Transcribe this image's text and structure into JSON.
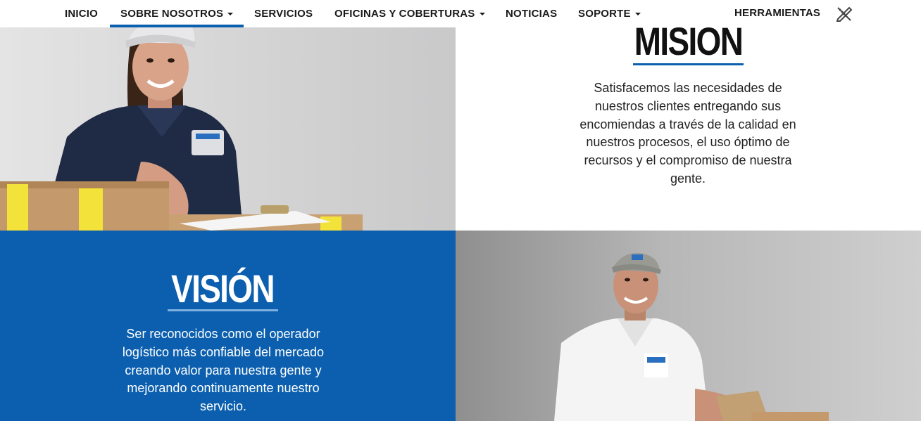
{
  "nav": {
    "items": [
      {
        "label": "INICIO",
        "dropdown": false
      },
      {
        "label": "SOBRE NOSOTROS",
        "dropdown": true
      },
      {
        "label": "SERVICIOS",
        "dropdown": false
      },
      {
        "label": "OFICINAS Y COBERTURAS",
        "dropdown": true
      },
      {
        "label": "NOTICIAS",
        "dropdown": false
      },
      {
        "label": "SOPORTE",
        "dropdown": true
      },
      {
        "label": "HERRAMIENTAS",
        "dropdown": false
      }
    ],
    "active_index": 1,
    "tools_icon": "pencil-ruler-icon"
  },
  "mission": {
    "title": "MISIÓN",
    "text": "Satisfacemos las necesidades de nuestros clientes entregando sus encomiendas a través de la calidad en nuestros procesos, el uso óptimo de recursos y el compromiso de nuestra gente."
  },
  "vision": {
    "title": "VISIÓN",
    "text": "Ser reconocidos como el operador logístico más confiable del mercado creando valor para nuestra gente y mejorando continuamente nuestro servicio."
  },
  "photos": {
    "top_left": "courier-woman-with-boxes-photo",
    "bottom_right": "courier-man-with-clipboard-photo"
  },
  "colors": {
    "brand_blue": "#0b5fae",
    "underline_light": "#7fb1e0",
    "box_tape_yellow": "#f2e23a",
    "uniform_navy": "#1f2a44"
  }
}
